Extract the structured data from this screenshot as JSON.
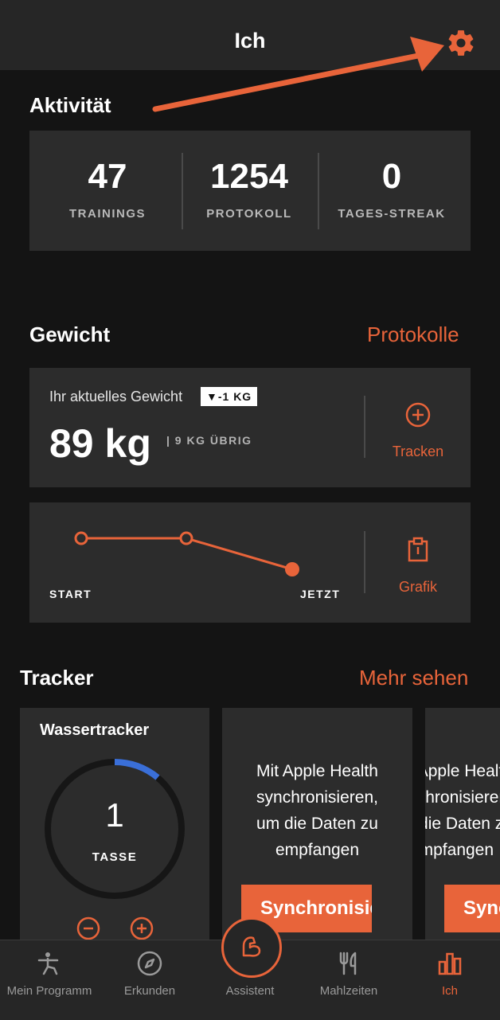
{
  "header": {
    "title": "Ich"
  },
  "activity": {
    "title": "Aktivität",
    "stats": [
      {
        "value": "47",
        "label": "TRAININGS"
      },
      {
        "value": "1254",
        "label": "PROTOKOLL"
      },
      {
        "value": "0",
        "label": "TAGES-STREAK"
      }
    ]
  },
  "weight": {
    "title": "Gewicht",
    "link": "Protokolle",
    "current_label": "Ihr aktuelles Gewicht",
    "badge": "▼-1 KG",
    "value": "89 kg",
    "remaining": "| 9 KG ÜBRIG",
    "track_label": "Tracken",
    "chart_start": "START",
    "chart_now": "JETZT",
    "chart_label": "Grafik"
  },
  "tracker": {
    "title": "Tracker",
    "link": "Mehr sehen",
    "water": {
      "title": "Wassertracker",
      "value": "1",
      "unit": "TASSE"
    },
    "promo": {
      "line1": "Mit Apple Health",
      "line2": "synchronisieren,",
      "line3": "um die Daten zu",
      "line4": "empfangen",
      "button": "Synchronisieren"
    },
    "promo2": {
      "line1": "Mit Apple Health",
      "line2": "synchronisieren,",
      "line3": "um die Daten zu",
      "line4": "empfangen",
      "button": "Synchronisieren"
    }
  },
  "tabs": [
    {
      "label": "Mein Programm",
      "icon": "program-icon"
    },
    {
      "label": "Erkunden",
      "icon": "compass-icon"
    },
    {
      "label": "Assistent",
      "icon": "assistant-icon"
    },
    {
      "label": "Mahlzeiten",
      "icon": "fork-knife-icon"
    },
    {
      "label": "Ich",
      "icon": "chart-bars-icon"
    }
  ],
  "colors": {
    "accent": "#e8643a",
    "background": "#141414",
    "card": "#2c2c2c",
    "ring_progress": "#3a6fd8"
  }
}
